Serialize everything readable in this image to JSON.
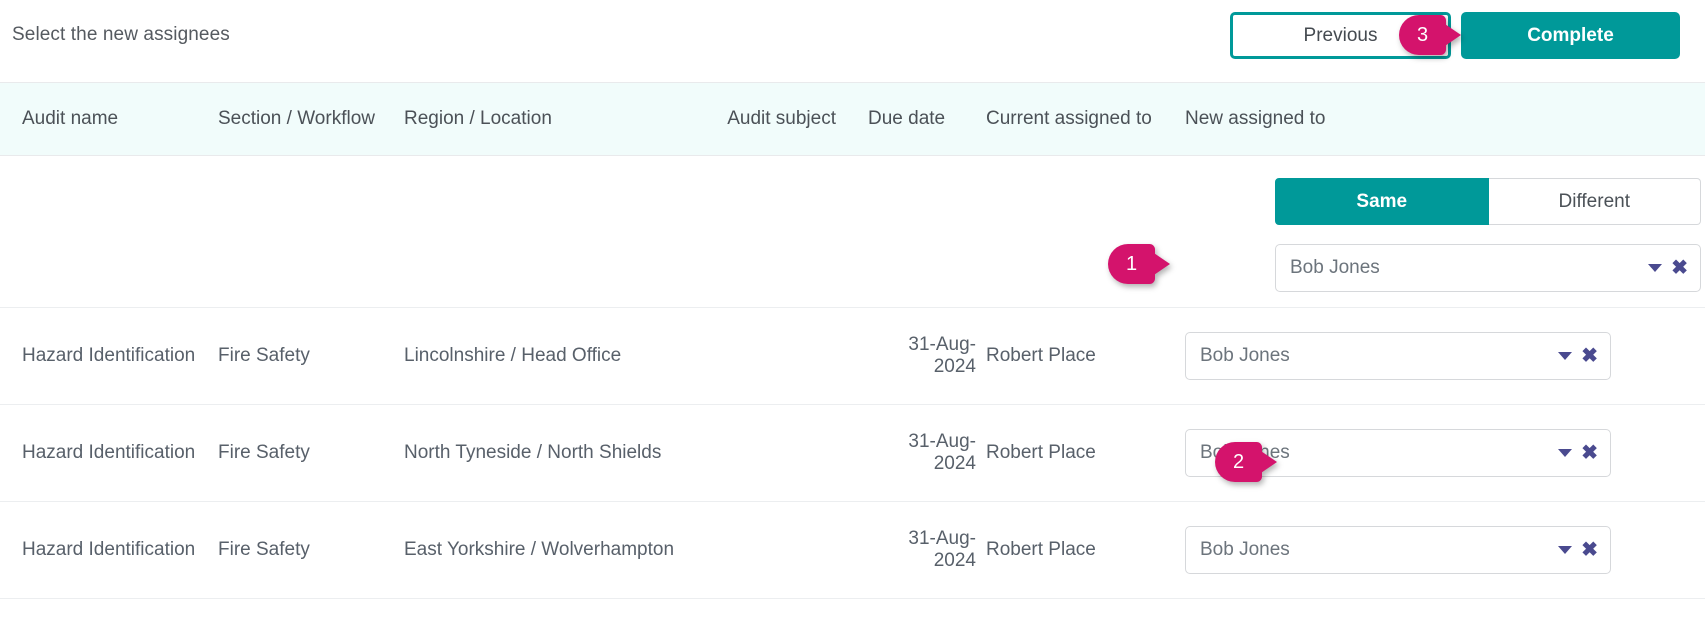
{
  "header": {
    "subtitle": "Select the new assignees",
    "previous_label": "Previous",
    "complete_label": "Complete"
  },
  "colors": {
    "accent_teal": "#009999",
    "marker_pink": "#d4136c",
    "header_bg": "#f1fcfb",
    "icon_indigo": "#4a4a8f",
    "text_grey": "#58606a"
  },
  "table": {
    "columns": [
      "Audit name",
      "Section / Workflow",
      "Region / Location",
      "Audit subject",
      "Due date",
      "Current assigned to",
      "New assigned to"
    ],
    "assignee_mode": {
      "same_label": "Same",
      "different_label": "Different",
      "selected": "Same"
    },
    "master_assignee": {
      "value": "Bob Jones",
      "caret_icon": "chevron-down-icon",
      "clear_icon": "close-icon"
    },
    "rows": [
      {
        "audit_name": "Hazard Identification",
        "section_workflow": "Fire Safety",
        "region_location": "Lincolnshire / Head Office",
        "audit_subject": "",
        "due_date": "31-Aug-2024",
        "current_assigned_to": "Robert Place",
        "new_assigned_to": "Bob Jones"
      },
      {
        "audit_name": "Hazard Identification",
        "section_workflow": "Fire Safety",
        "region_location": "North Tyneside / North Shields",
        "audit_subject": "",
        "due_date": "31-Aug-2024",
        "current_assigned_to": "Robert Place",
        "new_assigned_to": "Bob Jones"
      },
      {
        "audit_name": "Hazard Identification",
        "section_workflow": "Fire Safety",
        "region_location": "East Yorkshire / Wolverhampton",
        "audit_subject": "",
        "due_date": "31-Aug-2024",
        "current_assigned_to": "Robert Place",
        "new_assigned_to": "Bob Jones"
      }
    ]
  },
  "markers": [
    {
      "id": "1",
      "label": "1"
    },
    {
      "id": "2",
      "label": "2"
    },
    {
      "id": "3",
      "label": "3"
    }
  ]
}
